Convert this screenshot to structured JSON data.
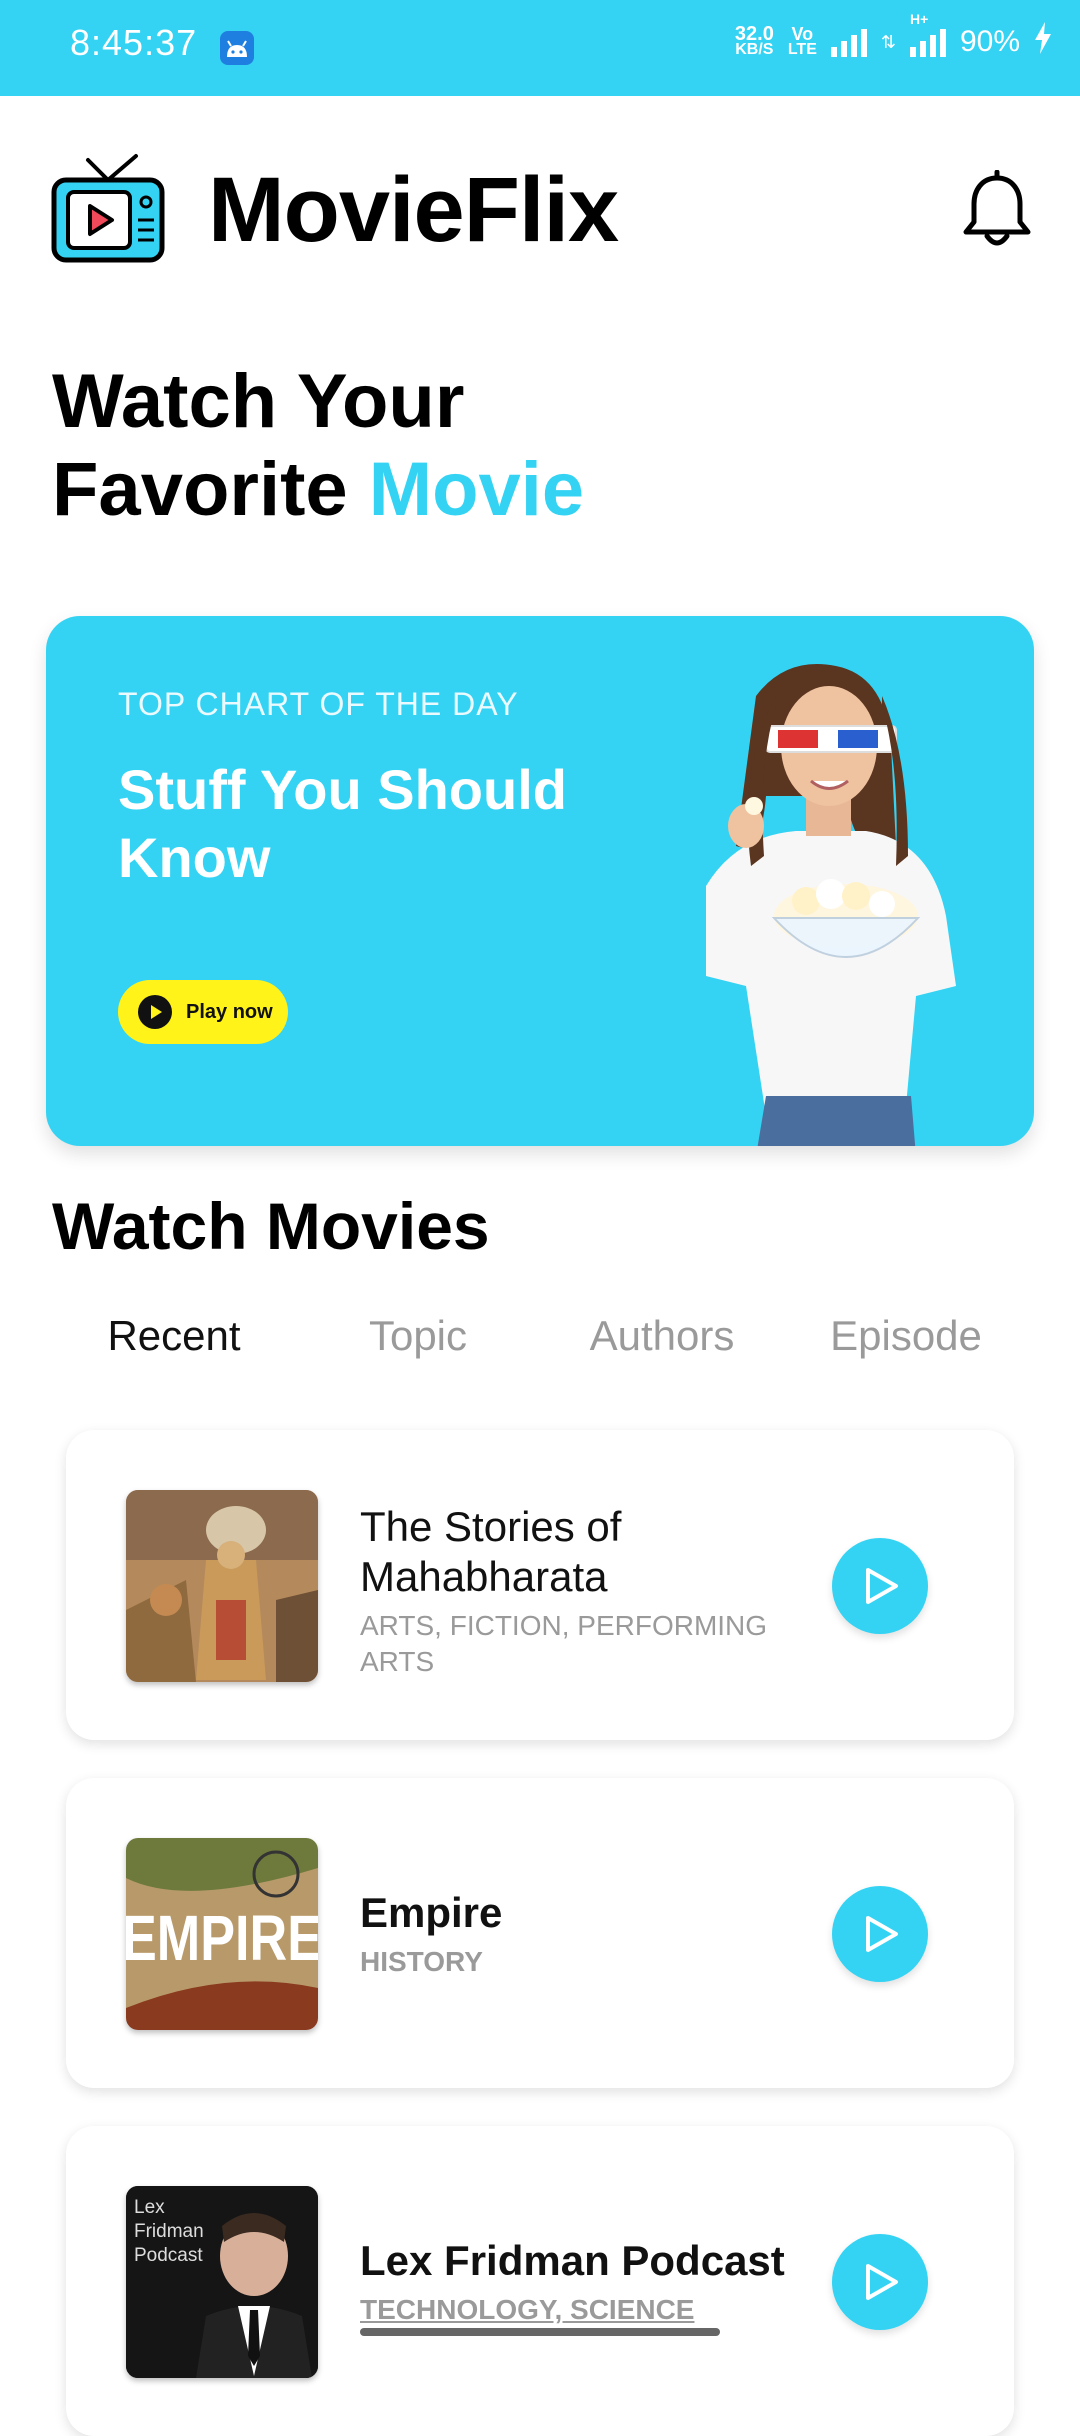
{
  "status_bar": {
    "time": "8:45:37",
    "net_speed": "32.0",
    "net_unit": "KB/S",
    "volte_top": "Vo",
    "volte_bottom": "LTE",
    "hplus": "H+",
    "battery": "90%"
  },
  "header": {
    "app_name": "MovieFlix",
    "logo_icon": "tv-play-icon",
    "bell_icon": "bell-icon"
  },
  "headline": {
    "line1": "Watch Your",
    "line2_prefix": "Favorite ",
    "line2_accent": "Movie"
  },
  "hero": {
    "eyebrow": "TOP CHART OF THE DAY",
    "title": "Stuff You Should Know",
    "button_label": "Play now"
  },
  "section": {
    "title": "Watch Movies"
  },
  "tabs": [
    {
      "label": "Recent",
      "active": true
    },
    {
      "label": "Topic",
      "active": false
    },
    {
      "label": "Authors",
      "active": false
    },
    {
      "label": "Episode",
      "active": false
    }
  ],
  "items": [
    {
      "title": "The Stories of Mahabharata",
      "tags": "ARTS, FICTION, PERFORMING ARTS"
    },
    {
      "title": "Empire",
      "tags": "HISTORY",
      "thumb_text": "EMPIRE"
    },
    {
      "title": "Lex Fridman Podcast",
      "tags": "TECHNOLOGY, SCIENCE",
      "thumb_text": "Lex Fridman Podcast"
    }
  ],
  "colors": {
    "accent": "#34d3f3",
    "button_yellow": "#fff31a"
  }
}
